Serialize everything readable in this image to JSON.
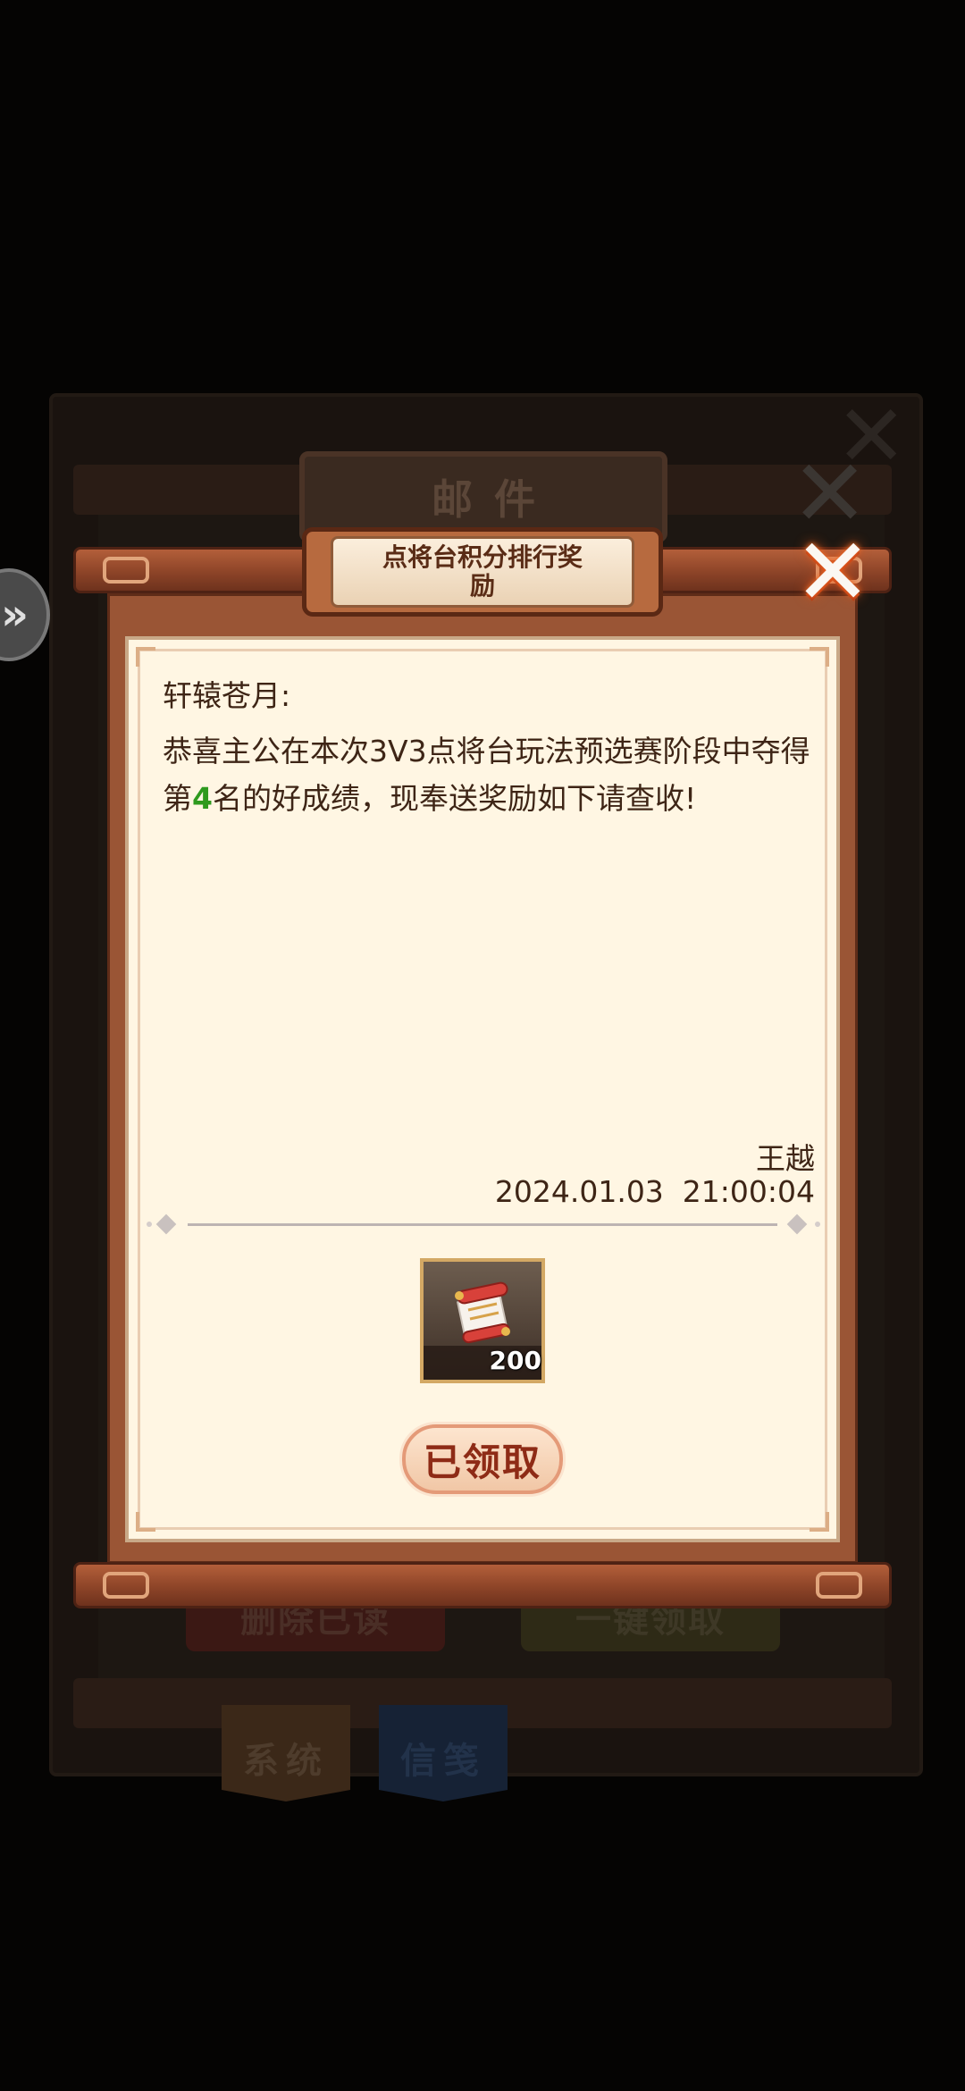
{
  "background": {
    "window_title": "邮件",
    "delete_read_label": "删除已读",
    "claim_all_label": "一键领取",
    "tab_system": "系统",
    "tab_letters": "信笺"
  },
  "mail": {
    "subject": "点将台积分排行奖励",
    "greeting": "轩辕苍月:",
    "body_before": "恭喜主公在本次3V3点将台玩法预选赛阶段中夺得第",
    "rank": "4",
    "body_after": "名的好成绩，现奉送奖励如下请查收!",
    "sender": "王越",
    "datetime": "2024.01.03  21:00:04",
    "attachment": {
      "icon": "scroll-icon",
      "count": "200"
    },
    "claimed_label": "已领取"
  },
  "colors": {
    "rank_highlight": "#2e9a1e",
    "paper": "#fff6e3",
    "frame": "#9a5535",
    "text": "#3e2516"
  }
}
